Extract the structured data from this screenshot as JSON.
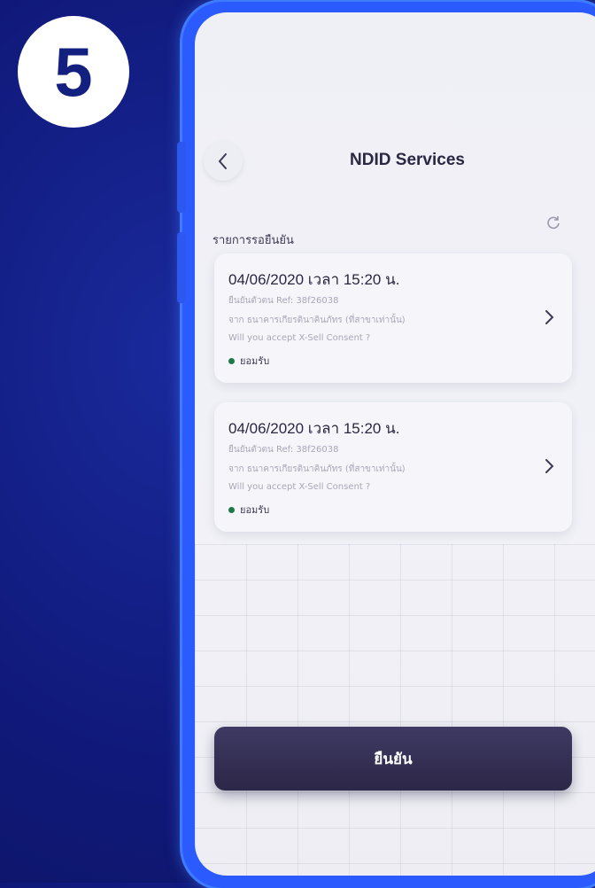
{
  "step": {
    "number": "5"
  },
  "header": {
    "title": "NDID Services"
  },
  "section": {
    "label": "รายการรอยืนยัน"
  },
  "requests": [
    {
      "datetime": "04/06/2020 เวลา 15:20 น.",
      "line1": "ยืนยันตัวตน Ref: 38f26038",
      "line2": "จาก ธนาคารเกียรตินาคินภัทร (ที่สาขาเท่านั้น)",
      "line3": "Will you accept X-Sell Consent ?",
      "status": "ยอมรับ"
    },
    {
      "datetime": "04/06/2020 เวลา 15:20 น.",
      "line1": "ยืนยันตัวตน Ref: 38f26038",
      "line2": "จาก ธนาคารเกียรตินาคินภัทร (ที่สาขาเท่านั้น)",
      "line3": "Will you accept X-Sell Consent ?",
      "status": "ยอมรับ"
    }
  ],
  "footer": {
    "confirm_label": "ยืนยัน"
  },
  "colors": {
    "background": "#10197a",
    "frame": "#2b5bff",
    "button": "#332e52",
    "status_dot": "#1b7a4a"
  }
}
